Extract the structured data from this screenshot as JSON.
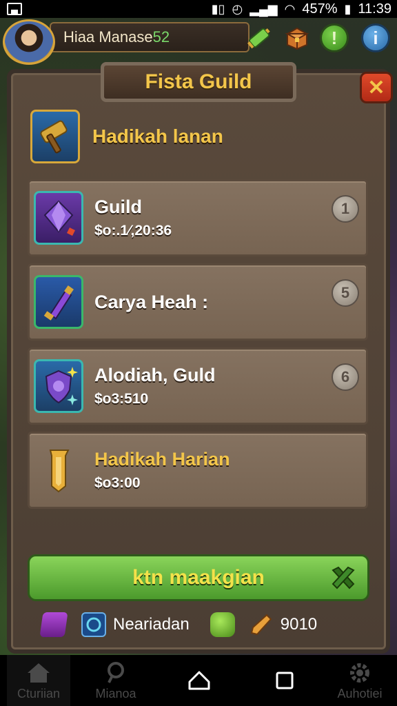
{
  "status_bar": {
    "battery": "457%",
    "time": "11:39"
  },
  "hud": {
    "player_name": "Hiaa Manase",
    "player_level": "52"
  },
  "panel": {
    "title": "Fista Guild",
    "header_label": "Hadikah lanan",
    "rows": [
      {
        "title": "Guild",
        "subtitle": "$o:.1⁄,20:36",
        "rank": "1"
      },
      {
        "title": "Carya Heah :",
        "subtitle": "",
        "rank": "5"
      },
      {
        "title": "Alodiah, Guld",
        "subtitle": "$o3:510",
        "rank": "6"
      },
      {
        "title": "Hadikah Harian",
        "subtitle": "$o3:00",
        "rank": ""
      }
    ],
    "cta_label": "ktn maakgian",
    "resources": {
      "label": "Neariadan",
      "amount": "9010"
    }
  },
  "nav": {
    "home": "Cturiian",
    "search": "Mianoa",
    "settings": "Auhotiei"
  },
  "colors": {
    "gold": "#f3c64a",
    "cta_green": "#6ab840",
    "close_red": "#d03a20"
  }
}
